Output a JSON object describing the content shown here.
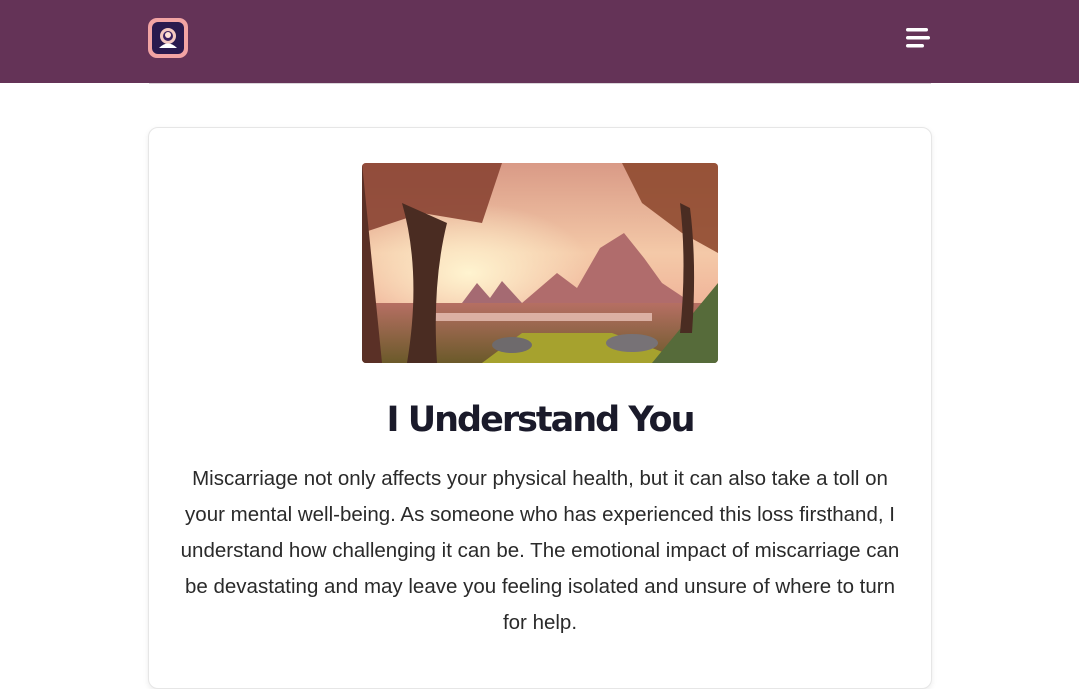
{
  "header": {
    "background_color": "#643357",
    "logo": {
      "icon": "app-logo-icon",
      "label": ""
    },
    "menu": {
      "icon": "hamburger-menu-icon"
    }
  },
  "card": {
    "image": {
      "description_icon": "landscape-illustration"
    },
    "title": "I Understand You",
    "body": "Miscarriage not only affects your physical health, but it can also take a toll on your mental well-being. As someone who has experienced this loss firsthand, I understand how challenging it can be. The emotional impact of miscarriage can be devastating and may leave you feeling isolated and unsure of where to turn for help."
  }
}
